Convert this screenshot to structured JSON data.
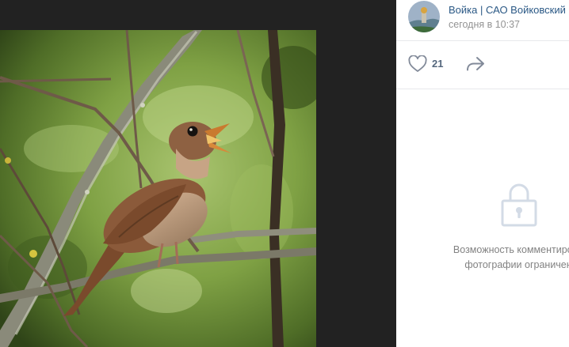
{
  "post": {
    "author": "Войка | САО Войковский",
    "time": "сегодня в 10:37",
    "likes": "21"
  },
  "comments": {
    "line1": "Возможность комментирова",
    "line2": "фотографии ограничен"
  },
  "icons": {
    "like": "heart-icon",
    "share": "share-arrow-icon",
    "lock": "lock-icon"
  },
  "colors": {
    "link": "#2a5885",
    "muted": "#939393",
    "viewer_bg": "#222222",
    "icon": "#828a99"
  }
}
